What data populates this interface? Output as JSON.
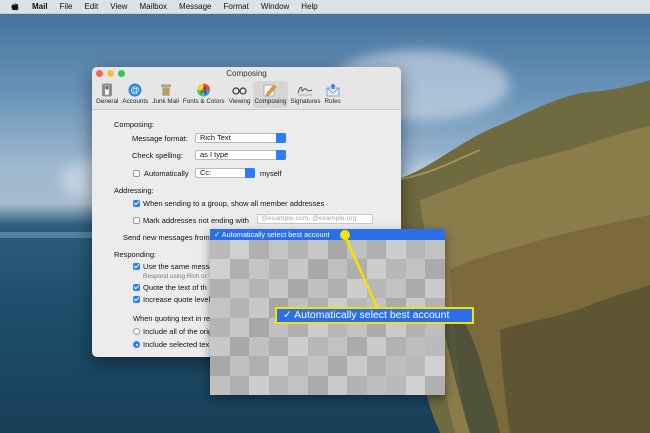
{
  "menubar": {
    "items": [
      "Mail",
      "File",
      "Edit",
      "View",
      "Mailbox",
      "Message",
      "Format",
      "Window",
      "Help"
    ]
  },
  "window": {
    "title": "Composing",
    "toolbar": [
      "General",
      "Accounts",
      "Junk Mail",
      "Fonts & Colors",
      "Viewing",
      "Composing",
      "Signatures",
      "Rules"
    ]
  },
  "composing": {
    "section": "Composing:",
    "message_format_label": "Message format:",
    "message_format_value": "Rich Text",
    "check_spelling_label": "Check spelling:",
    "check_spelling_value": "as I type",
    "automatically_label": "Automatically",
    "automatically_value": "Cc:",
    "myself_label": "myself"
  },
  "addressing": {
    "section": "Addressing:",
    "group_label": "When sending to a group, show all member addresses",
    "mark_label": "Mark addresses not ending with",
    "mark_placeholder": "@example.com, @example.org",
    "send_from_label": "Send new messages from"
  },
  "responding": {
    "section": "Responding:",
    "same_label": "Use the same messa",
    "same_hint": "Respond using Rich or",
    "quote_label": "Quote the text of th",
    "increase_label": "Increase quote level",
    "when_quoting_label": "When quoting text in re",
    "include_all_label": "Include all of the orig",
    "include_selected_label": "Include selected tex"
  },
  "dropdown": {
    "selected": "✓ Automatically select best account"
  },
  "callout": {
    "text": "✓ Automatically select best account"
  },
  "colors": {
    "accent": "#2e7cf6",
    "highlight": "#f2e200",
    "selection": "#2a6ee8"
  }
}
